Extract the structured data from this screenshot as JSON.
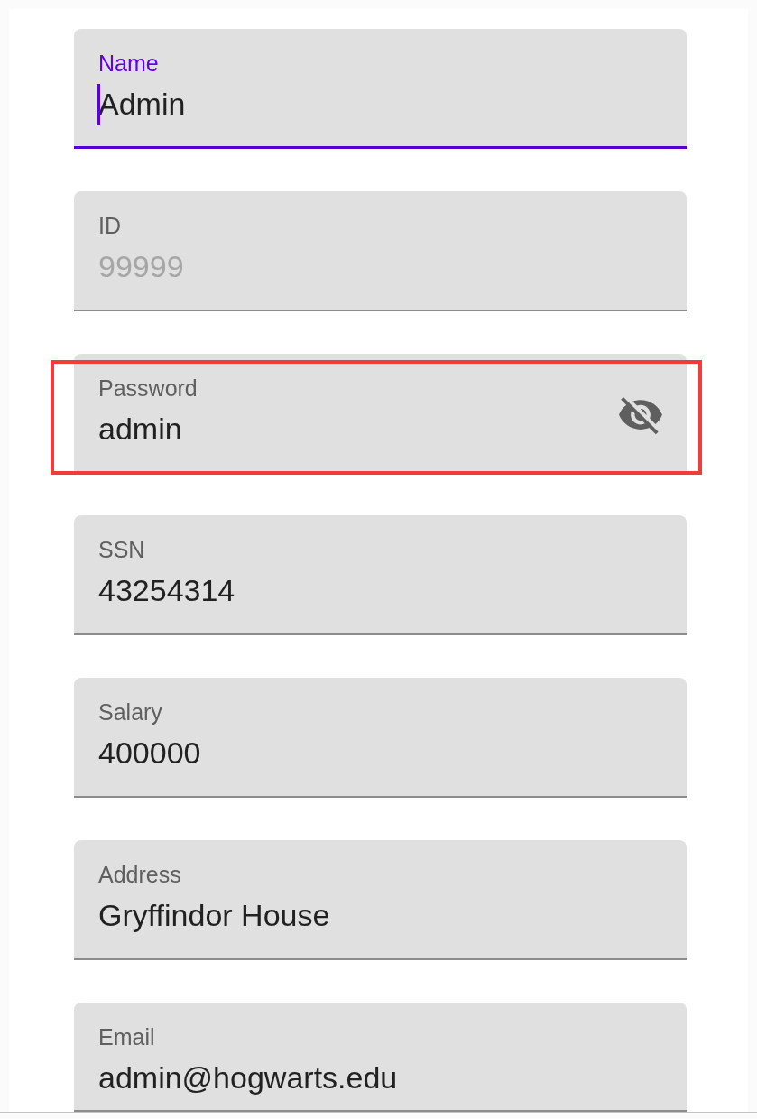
{
  "fields": [
    {
      "kind": "text",
      "label": "Name",
      "value": "Admin",
      "focused": true,
      "highlighted": false
    },
    {
      "kind": "text",
      "label": "ID",
      "placeholder": "99999",
      "focused": false,
      "highlighted": false
    },
    {
      "kind": "password",
      "label": "Password",
      "value": "admin",
      "focused": false,
      "highlighted": true
    },
    {
      "kind": "text",
      "label": "SSN",
      "value": "43254314",
      "focused": false,
      "highlighted": false
    },
    {
      "kind": "text",
      "label": "Salary",
      "value": "400000",
      "focused": false,
      "highlighted": false
    },
    {
      "kind": "text",
      "label": "Address",
      "value": "Gryffindor House",
      "focused": false,
      "highlighted": false
    },
    {
      "kind": "text",
      "label": "Email",
      "value": "admin@hogwarts.edu",
      "focused": false,
      "highlighted": false
    }
  ]
}
